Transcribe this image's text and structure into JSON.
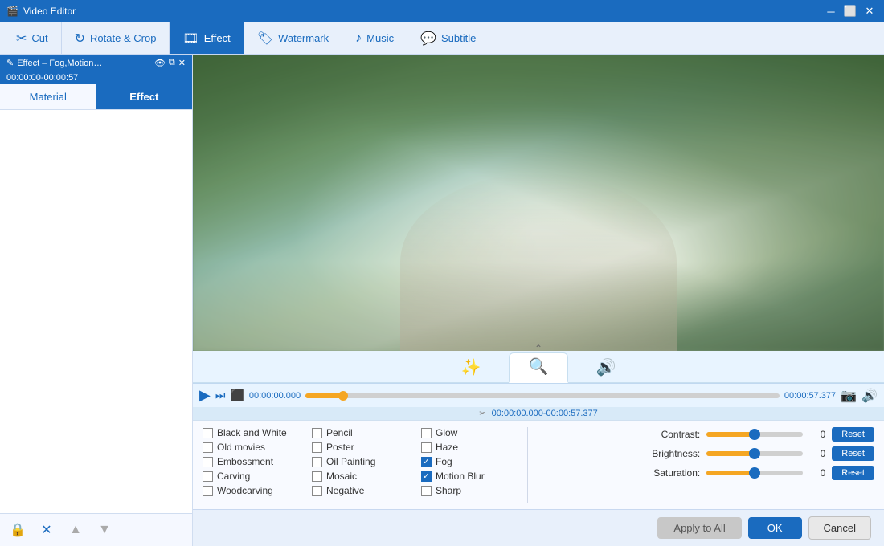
{
  "titleBar": {
    "title": "Video Editor",
    "activeTab": "Effect – Fog,Motion…",
    "timeRange": "00:00:00-00:00:57",
    "controls": [
      "minimize",
      "restore",
      "close"
    ]
  },
  "tabs": [
    {
      "id": "cut",
      "label": "Cut",
      "icon": "✂"
    },
    {
      "id": "rotate",
      "label": "Rotate & Crop",
      "icon": "↻"
    },
    {
      "id": "effect",
      "label": "Effect",
      "icon": "🎬",
      "active": true
    },
    {
      "id": "watermark",
      "label": "Watermark",
      "icon": "🎞"
    },
    {
      "id": "music",
      "label": "Music",
      "icon": "♪"
    },
    {
      "id": "subtitle",
      "label": "Subtitle",
      "icon": "💬"
    }
  ],
  "sidebar": {
    "tabs": [
      "Material",
      "Effect"
    ],
    "activeTab": "Effect",
    "footer": {
      "timeLabel": "00:00:00-00:00:57"
    }
  },
  "effectTabs": [
    {
      "id": "enhance",
      "icon": "✨",
      "active": false
    },
    {
      "id": "blur",
      "icon": "🔍",
      "active": true
    },
    {
      "id": "audio",
      "icon": "🔊",
      "active": false
    }
  ],
  "player": {
    "currentTime": "00:00:00.000",
    "duration": "00:00:57.377",
    "timeRange": "00:00:00.000-00:00:57.377",
    "durationDisplay": "00:00:57.377",
    "progressPercent": 8
  },
  "effects": {
    "col1": [
      {
        "id": "bw",
        "label": "Black and White",
        "checked": false
      },
      {
        "id": "old",
        "label": "Old movies",
        "checked": false
      },
      {
        "id": "emboss",
        "label": "Embossment",
        "checked": false
      },
      {
        "id": "carving",
        "label": "Carving",
        "checked": false
      },
      {
        "id": "woodcarving",
        "label": "Woodcarving",
        "checked": false
      }
    ],
    "col2": [
      {
        "id": "pencil",
        "label": "Pencil",
        "checked": false
      },
      {
        "id": "poster",
        "label": "Poster",
        "checked": false
      },
      {
        "id": "oilpainting",
        "label": "Oil Painting",
        "checked": false
      },
      {
        "id": "mosaic",
        "label": "Mosaic",
        "checked": false
      },
      {
        "id": "negative",
        "label": "Negative",
        "checked": false
      }
    ],
    "col3": [
      {
        "id": "glow",
        "label": "Glow",
        "checked": false
      },
      {
        "id": "haze",
        "label": "Haze",
        "checked": false
      },
      {
        "id": "fog",
        "label": "Fog",
        "checked": true
      },
      {
        "id": "motionblur",
        "label": "Motion Blur",
        "checked": true
      },
      {
        "id": "sharp",
        "label": "Sharp",
        "checked": false
      }
    ]
  },
  "sliders": {
    "contrast": {
      "label": "Contrast:",
      "value": 0,
      "thumbPercent": 50
    },
    "brightness": {
      "label": "Brightness:",
      "value": 0,
      "thumbPercent": 50
    },
    "saturation": {
      "label": "Saturation:",
      "value": 0,
      "thumbPercent": 50
    }
  },
  "actions": {
    "applyAll": "Apply to All",
    "ok": "OK",
    "cancel": "Cancel",
    "reset": "Reset"
  }
}
